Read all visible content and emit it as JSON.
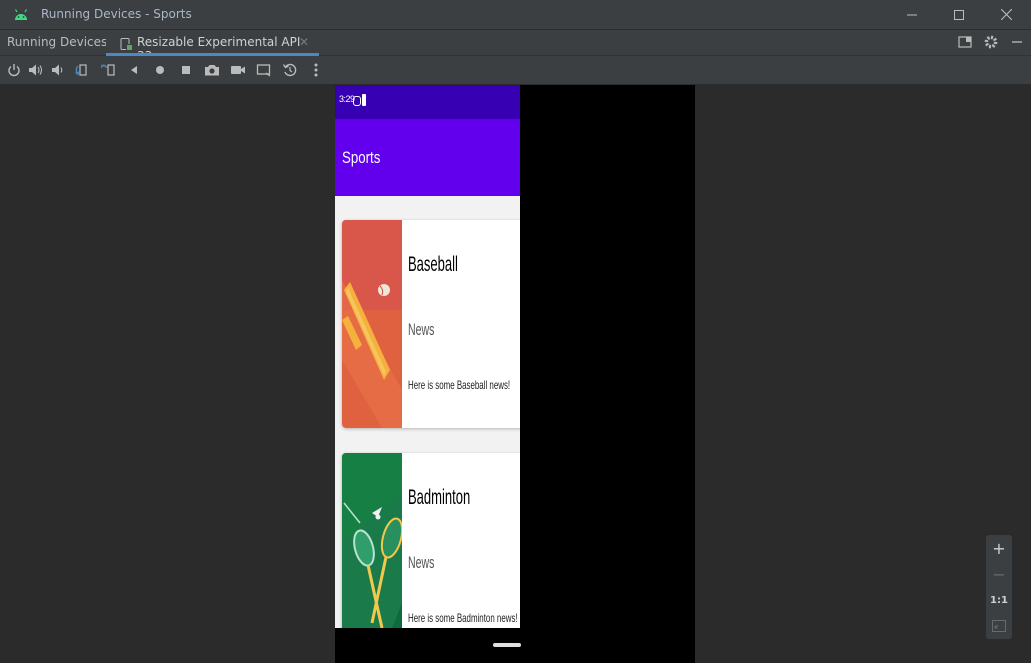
{
  "window": {
    "title": "Running Devices - Sports",
    "controls": [
      "minimize-icon",
      "maximize-icon",
      "close-icon"
    ]
  },
  "tabbar": {
    "label": "Running Devices:",
    "tabs": [
      {
        "label": "Resizable Experimental API 33",
        "icon": "device-icon",
        "active": true
      }
    ],
    "right_icons": [
      "layout-icon",
      "gear-icon",
      "minimize-panel-icon"
    ]
  },
  "toolbar": {
    "icons": [
      "power-icon",
      "volume-up-icon",
      "volume-down-icon",
      "rotate-left-icon",
      "rotate-right-icon",
      "back-icon",
      "home-icon",
      "overview-icon",
      "screenshot-icon",
      "screen-record-icon",
      "device-frame-icon",
      "snapshot-icon",
      "more-icon"
    ]
  },
  "device": {
    "status_time": "3:29",
    "app_title": "Sports",
    "cards": [
      {
        "title": "Baseball",
        "subtitle": "News",
        "body": "Here is some Baseball news!",
        "image": "baseball-image"
      },
      {
        "title": "Badminton",
        "subtitle": "News",
        "body": "Here is some Badminton news!",
        "image": "badminton-image"
      }
    ]
  },
  "zoom": {
    "zoom_in": "+",
    "zoom_out": "−",
    "actual_size": "1:1",
    "fit_icon": "fit-screen-icon"
  },
  "colors": {
    "ide_bg": "#2b2b2b",
    "ide_panel": "#3c3f41",
    "tab_accent": "#4a88c7",
    "status_bar": "#3700b3",
    "app_bar": "#6200ee"
  }
}
